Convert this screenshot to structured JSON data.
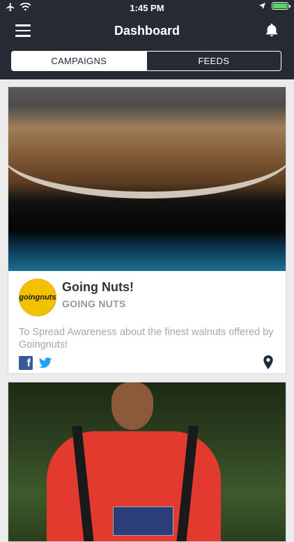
{
  "status_bar": {
    "time": "1:45 PM"
  },
  "header": {
    "title": "Dashboard"
  },
  "tabs": [
    {
      "label": "CAMPAIGNS",
      "active": true
    },
    {
      "label": "FEEDS",
      "active": false
    }
  ],
  "campaigns": [
    {
      "title": "Going Nuts!",
      "brand": "GOING NUTS",
      "logo_text": "goingnuts",
      "description": "To Spread Awareness about the finest walnuts offered by Goingnuts!",
      "social": [
        "facebook-icon",
        "twitter-icon"
      ]
    }
  ],
  "colors": {
    "header_bg": "#262b33",
    "accent": "#3b5998",
    "logo_bg": "#f2c200"
  }
}
